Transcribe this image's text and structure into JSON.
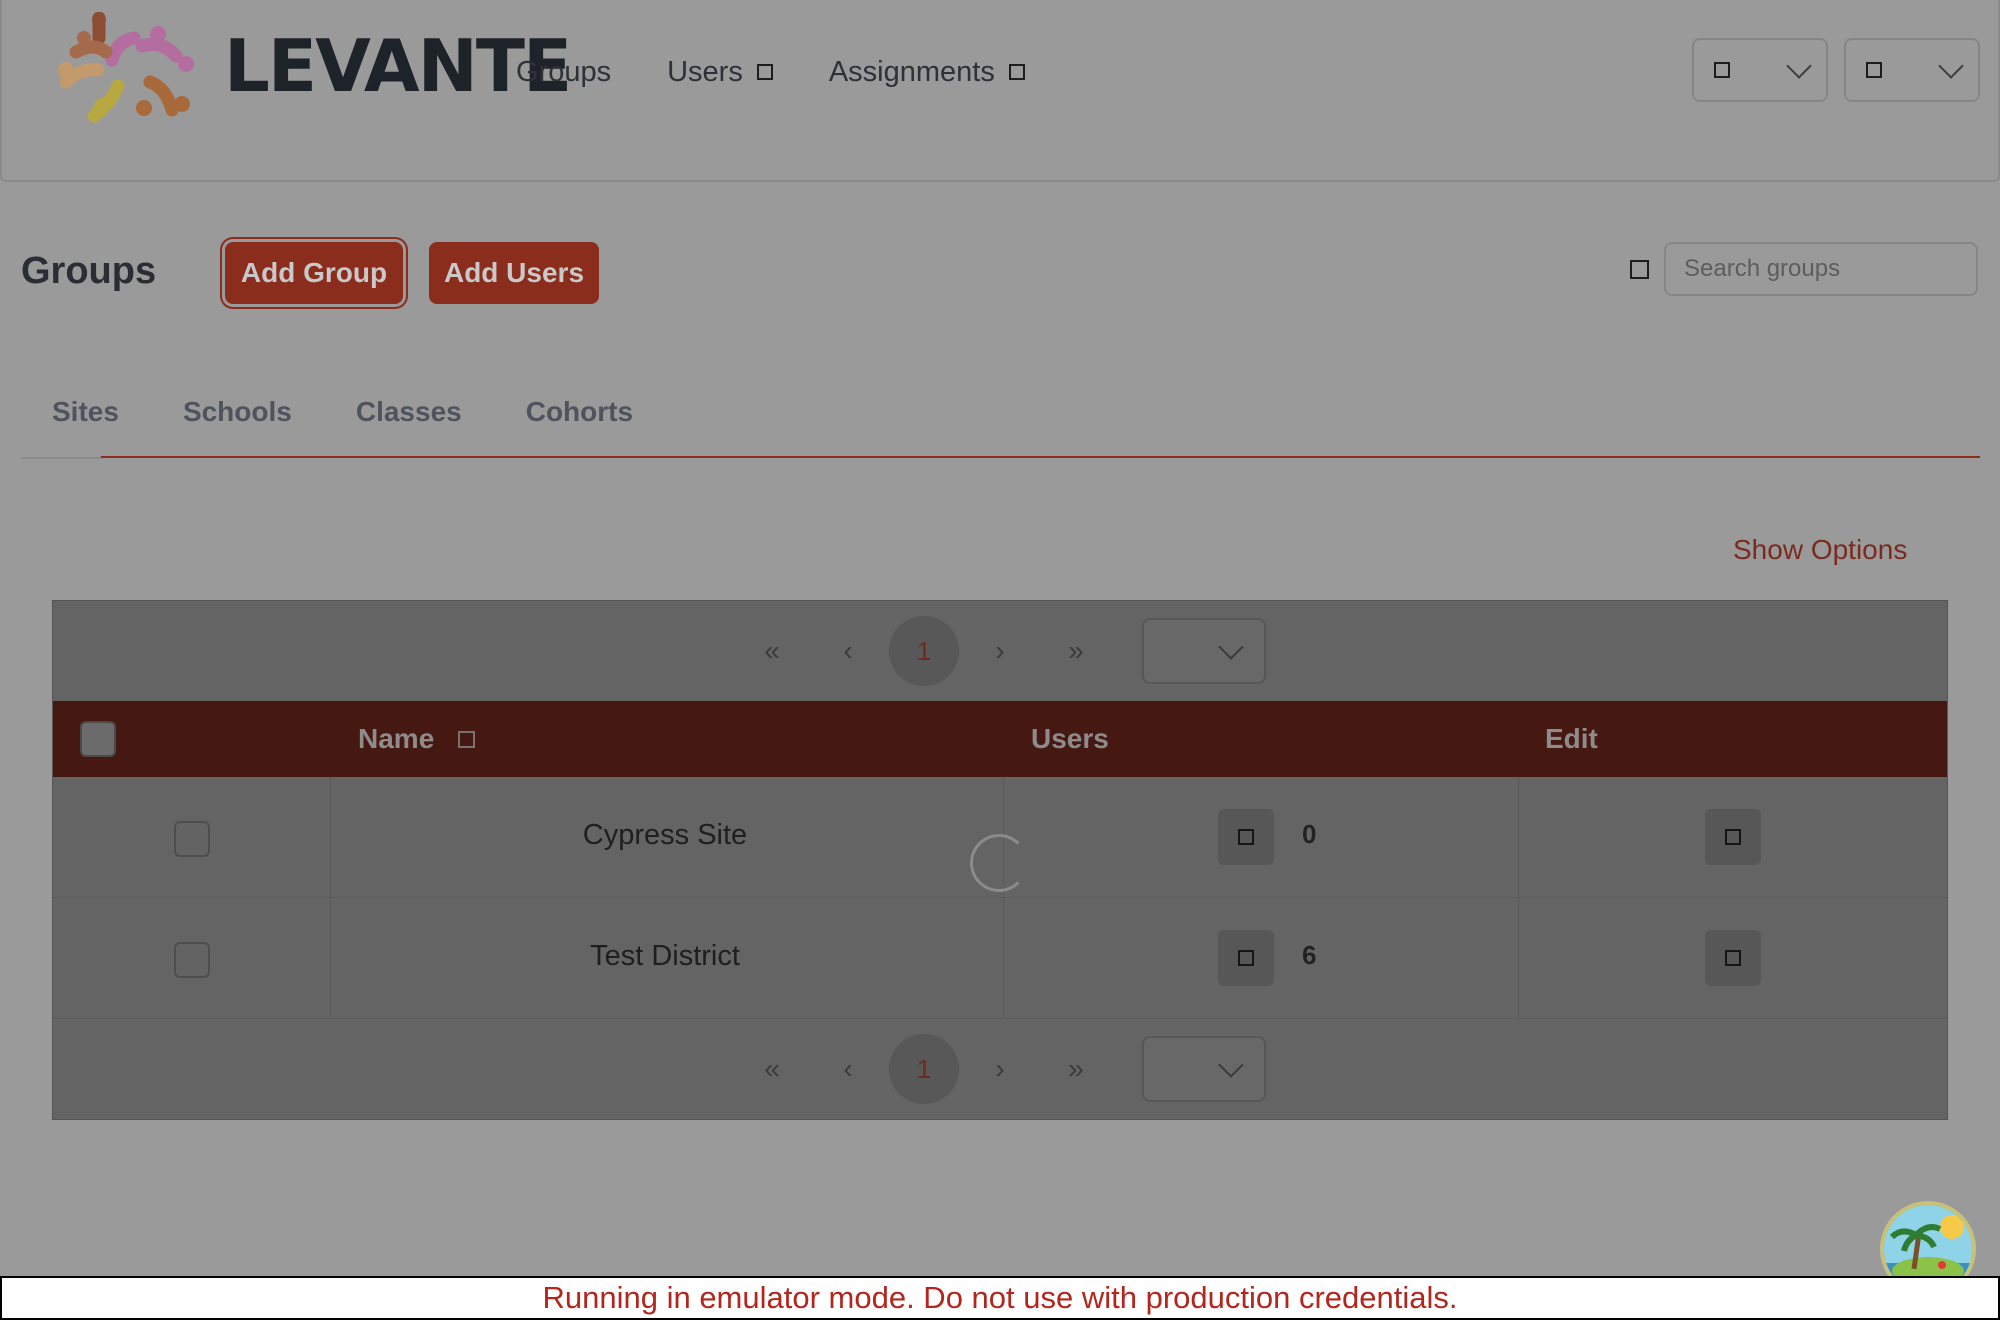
{
  "app": {
    "logo_text": "LEVANTE"
  },
  "nav": {
    "groups": "Groups",
    "users": "Users",
    "assignments": "Assignments"
  },
  "page": {
    "title": "Groups"
  },
  "actions": {
    "add_group": "Add Group",
    "add_users": "Add Users"
  },
  "search": {
    "placeholder": "Search groups",
    "value": ""
  },
  "tabs": [
    "Sites",
    "Schools",
    "Classes",
    "Cohorts"
  ],
  "tabs_labels": {
    "t0": "Sites",
    "t1": "Schools",
    "t2": "Classes",
    "t3": "Cohorts"
  },
  "active_tab": "Sites",
  "show_options": "Show Options",
  "pagination": {
    "first": "«",
    "prev": "‹",
    "current": "1",
    "next": "›",
    "last": "»"
  },
  "table": {
    "columns": {
      "name": "Name",
      "users": "Users",
      "edit": "Edit"
    },
    "rows": [
      {
        "name": "Cypress Site",
        "users": "0"
      },
      {
        "name": "Test District",
        "users": "6"
      }
    ]
  },
  "banner": {
    "text": "Running in emulator mode. Do not use with production credentials."
  },
  "colors": {
    "accent": "#8a2d1c",
    "table_header": "#451812",
    "banner_text": "#b3261e"
  },
  "icons": [
    "square-icon",
    "chevron-down-icon",
    "checkbox-icon",
    "spinner-icon",
    "avatar-image"
  ]
}
